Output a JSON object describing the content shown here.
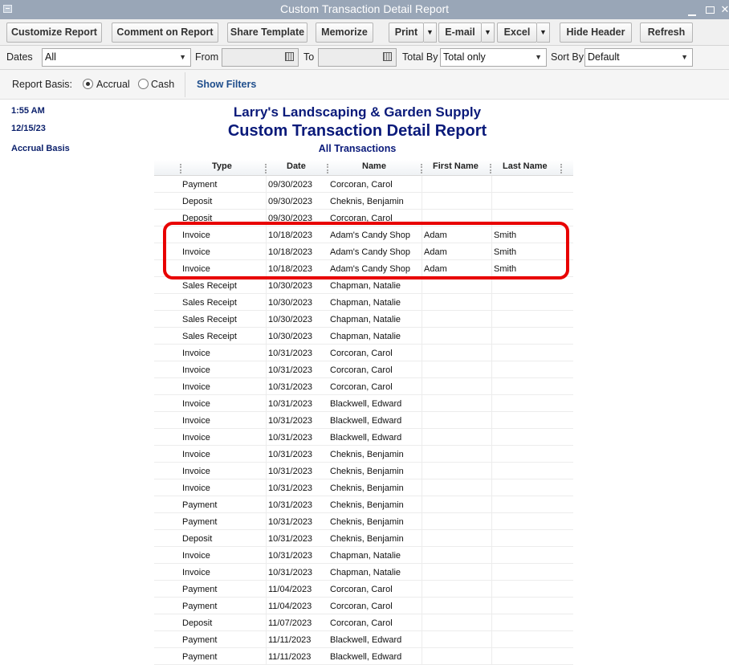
{
  "window": {
    "title": "Custom Transaction Detail Report"
  },
  "toolbar": {
    "customize": "Customize Report",
    "comment": "Comment on Report",
    "share": "Share Template",
    "memorize": "Memorize",
    "print": "Print",
    "email": "E-mail",
    "excel": "Excel",
    "hide_header": "Hide Header",
    "refresh": "Refresh"
  },
  "filters": {
    "dates_label": "Dates",
    "dates_value": "All",
    "from_label": "From",
    "from_value": "",
    "to_label": "To",
    "to_value": "",
    "total_by_label": "Total By",
    "total_by_value": "Total only",
    "sort_by_label": "Sort By",
    "sort_by_value": "Default"
  },
  "basis": {
    "label": "Report Basis:",
    "accrual": "Accrual",
    "cash": "Cash",
    "selected": "accrual",
    "show_filters": "Show Filters"
  },
  "report": {
    "time": "1:55 AM",
    "date": "12/15/23",
    "basis": "Accrual Basis",
    "company": "Larry's Landscaping & Garden Supply",
    "title": "Custom Transaction Detail Report",
    "subtitle": "All Transactions",
    "columns": [
      "Type",
      "Date",
      "Name",
      "First Name",
      "Last Name"
    ],
    "rows": [
      [
        "Payment",
        "09/30/2023",
        "Corcoran, Carol",
        "",
        ""
      ],
      [
        "Deposit",
        "09/30/2023",
        "Cheknis, Benjamin",
        "",
        ""
      ],
      [
        "Deposit",
        "09/30/2023",
        "Corcoran, Carol",
        "",
        ""
      ],
      [
        "Invoice",
        "10/18/2023",
        "Adam's Candy Shop",
        "Adam",
        "Smith"
      ],
      [
        "Invoice",
        "10/18/2023",
        "Adam's Candy Shop",
        "Adam",
        "Smith"
      ],
      [
        "Invoice",
        "10/18/2023",
        "Adam's Candy Shop",
        "Adam",
        "Smith"
      ],
      [
        "Sales Receipt",
        "10/30/2023",
        "Chapman, Natalie",
        "",
        ""
      ],
      [
        "Sales Receipt",
        "10/30/2023",
        "Chapman, Natalie",
        "",
        ""
      ],
      [
        "Sales Receipt",
        "10/30/2023",
        "Chapman, Natalie",
        "",
        ""
      ],
      [
        "Sales Receipt",
        "10/30/2023",
        "Chapman, Natalie",
        "",
        ""
      ],
      [
        "Invoice",
        "10/31/2023",
        "Corcoran, Carol",
        "",
        ""
      ],
      [
        "Invoice",
        "10/31/2023",
        "Corcoran, Carol",
        "",
        ""
      ],
      [
        "Invoice",
        "10/31/2023",
        "Corcoran, Carol",
        "",
        ""
      ],
      [
        "Invoice",
        "10/31/2023",
        "Blackwell, Edward",
        "",
        ""
      ],
      [
        "Invoice",
        "10/31/2023",
        "Blackwell, Edward",
        "",
        ""
      ],
      [
        "Invoice",
        "10/31/2023",
        "Blackwell, Edward",
        "",
        ""
      ],
      [
        "Invoice",
        "10/31/2023",
        "Cheknis, Benjamin",
        "",
        ""
      ],
      [
        "Invoice",
        "10/31/2023",
        "Cheknis, Benjamin",
        "",
        ""
      ],
      [
        "Invoice",
        "10/31/2023",
        "Cheknis, Benjamin",
        "",
        ""
      ],
      [
        "Payment",
        "10/31/2023",
        "Cheknis, Benjamin",
        "",
        ""
      ],
      [
        "Payment",
        "10/31/2023",
        "Cheknis, Benjamin",
        "",
        ""
      ],
      [
        "Deposit",
        "10/31/2023",
        "Cheknis, Benjamin",
        "",
        ""
      ],
      [
        "Invoice",
        "10/31/2023",
        "Chapman, Natalie",
        "",
        ""
      ],
      [
        "Invoice",
        "10/31/2023",
        "Chapman, Natalie",
        "",
        ""
      ],
      [
        "Payment",
        "11/04/2023",
        "Corcoran, Carol",
        "",
        ""
      ],
      [
        "Payment",
        "11/04/2023",
        "Corcoran, Carol",
        "",
        ""
      ],
      [
        "Deposit",
        "11/07/2023",
        "Corcoran, Carol",
        "",
        ""
      ],
      [
        "Payment",
        "11/11/2023",
        "Blackwell, Edward",
        "",
        ""
      ],
      [
        "Payment",
        "11/11/2023",
        "Blackwell, Edward",
        "",
        ""
      ]
    ]
  }
}
